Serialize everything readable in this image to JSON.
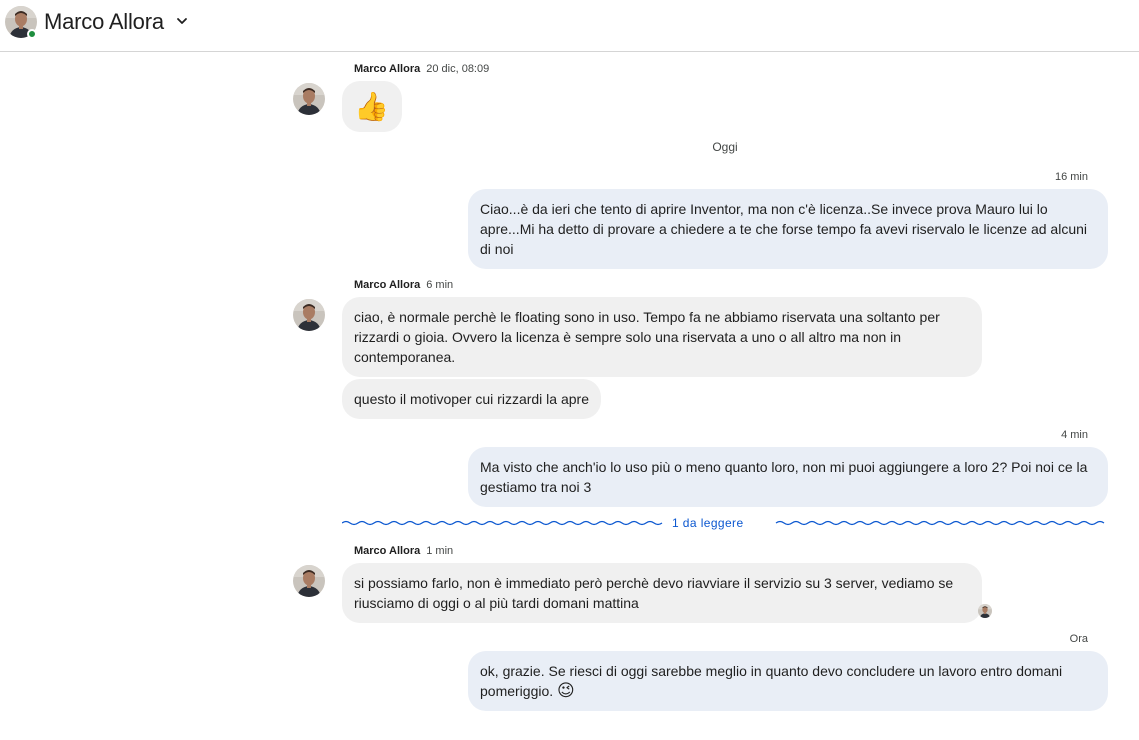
{
  "header": {
    "contact_name": "Marco Allora",
    "chevron_icon": "chevron-down-icon",
    "online_status_color": "#1e8e3e"
  },
  "day_separator": "Oggi",
  "unread_divider": "1 da leggere",
  "messages": [
    {
      "direction": "incoming",
      "sender": "Marco Allora",
      "time": "20 dic, 08:09",
      "text": "👍"
    },
    {
      "direction": "outgoing",
      "time": "16 min",
      "text": "Ciao...è da ieri che tento di aprire Inventor, ma non c'è licenza..Se invece prova Mauro lui lo apre...Mi ha detto di provare a chiedere a te che forse tempo fa avevi riservalo le licenze ad alcuni di noi"
    },
    {
      "direction": "incoming",
      "sender": "Marco Allora",
      "time": "6 min",
      "text": "ciao, è normale perchè le floating sono in uso. Tempo fa ne abbiamo riservata una soltanto per rizzardi o gioia. Ovvero la licenza è sempre solo una riservata a uno o all altro ma non in contemporanea."
    },
    {
      "direction": "incoming",
      "text": "questo il motivoper cui rizzardi la apre"
    },
    {
      "direction": "outgoing",
      "time": "4 min",
      "text": "Ma visto che anch'io lo uso più o meno quanto loro, non mi puoi aggiungere a loro 2? Poi noi ce la gestiamo tra noi 3"
    },
    {
      "direction": "incoming",
      "sender": "Marco Allora",
      "time": "1 min",
      "text": "si possiamo farlo, non è immediato però perchè devo riavviare il servizio su 3 server, vediamo se riusciamo di oggi o al più tardi domani mattina"
    },
    {
      "direction": "outgoing",
      "time": "Ora",
      "text": "ok, grazie. Se riesci di oggi sarebbe meglio in quanto devo concludere un lavoro entro domani pomeriggio.",
      "emoji": "😉"
    }
  ],
  "colors": {
    "incoming_bubble": "#f0f0f0",
    "outgoing_bubble": "#e9eef6",
    "unread_accent": "#0b57d0"
  }
}
